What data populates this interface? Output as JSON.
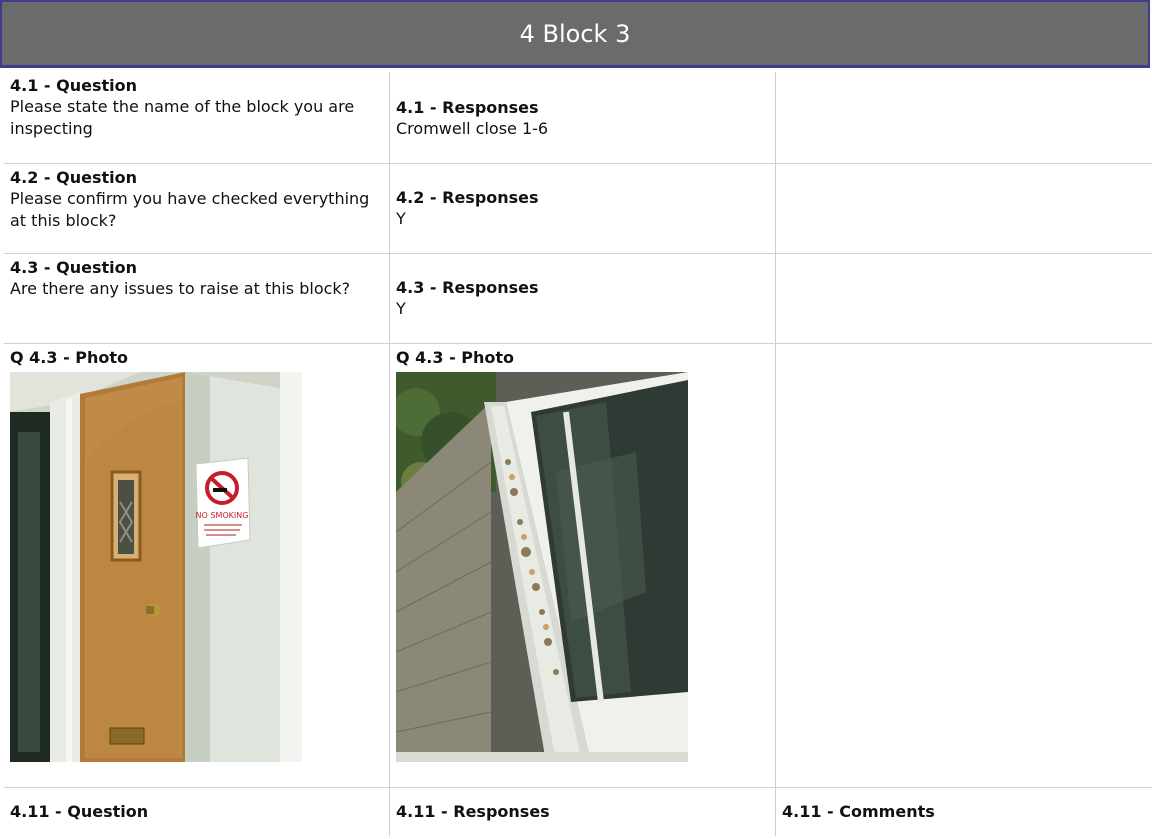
{
  "section": {
    "title": "4 Block 3"
  },
  "rows": [
    {
      "q_label": "4.1 - Question",
      "q_text": "Please state the name of the block you are inspecting",
      "r_label": "4.1 - Responses",
      "r_text": "Cromwell close 1-6"
    },
    {
      "q_label": "4.2 - Question",
      "q_text": "Please confirm you have checked everything at this block?",
      "r_label": "4.2 - Responses",
      "r_text": "Y"
    },
    {
      "q_label": "4.3 - Question",
      "q_text": "Are there any issues to raise at this block?",
      "r_label": "4.3 - Responses",
      "r_text": "Y"
    }
  ],
  "photos": {
    "left_label": "Q 4.3 - Photo",
    "right_label": "Q 4.3 - Photo"
  },
  "footer_row": {
    "q_label": "4.11 - Question",
    "r_label": "4.11 - Responses",
    "c_label": "4.11 - Comments"
  },
  "sign": {
    "line1": "NO SMOKING"
  }
}
